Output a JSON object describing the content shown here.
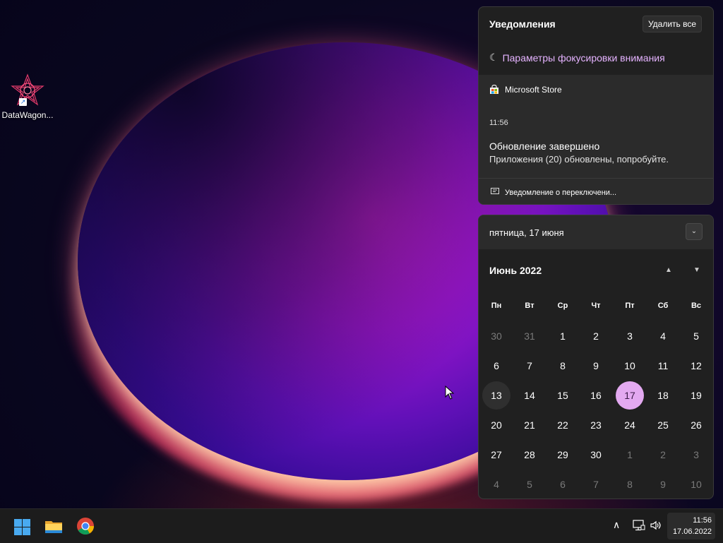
{
  "desktop": {
    "icons": [
      {
        "label": "DataWagon..."
      }
    ]
  },
  "notifications": {
    "title": "Уведомления",
    "clear_all": "Удалить все",
    "focus_assist": "Параметры фокусировки внимания",
    "toast": {
      "app": "Microsoft Store",
      "time": "11:56",
      "title": "Обновление завершено",
      "body": "Приложения (20) обновлены, попробуйте.",
      "footer": "Уведомление о переключени..."
    }
  },
  "calendar": {
    "date_header": "пятница, 17 июня",
    "month_label": "Июнь 2022",
    "weekdays": [
      "Пн",
      "Вт",
      "Ср",
      "Чт",
      "Пт",
      "Сб",
      "Вс"
    ],
    "days": [
      [
        "30",
        "31",
        "1",
        "2",
        "3",
        "4",
        "5"
      ],
      [
        "6",
        "7",
        "8",
        "9",
        "10",
        "11",
        "12"
      ],
      [
        "13",
        "14",
        "15",
        "16",
        "17",
        "18",
        "19"
      ],
      [
        "20",
        "21",
        "22",
        "23",
        "24",
        "25",
        "26"
      ],
      [
        "27",
        "28",
        "29",
        "30",
        "1",
        "2",
        "3"
      ],
      [
        "4",
        "5",
        "6",
        "7",
        "8",
        "9",
        "10"
      ]
    ],
    "today": "17",
    "accent": "#e3a9f0"
  },
  "taskbar": {
    "apps": [
      {
        "icon": "windows-start-icon"
      },
      {
        "icon": "file-explorer-icon"
      },
      {
        "icon": "chrome-icon"
      }
    ],
    "tray": {
      "icons": [
        "chevron-up-icon",
        "network-icon",
        "volume-icon"
      ]
    },
    "clock": {
      "time": "11:56",
      "date": "17.06.2022"
    }
  }
}
